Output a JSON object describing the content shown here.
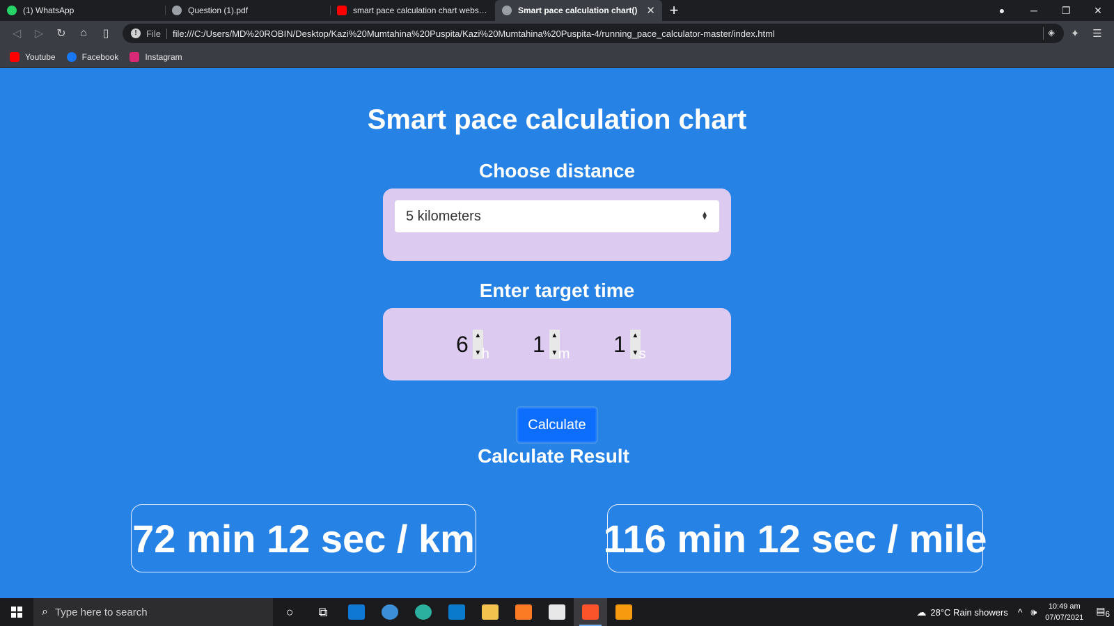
{
  "browser": {
    "tabs": [
      {
        "title": "(1) WhatsApp",
        "icon": "whatsapp-icon",
        "color": "#25d366"
      },
      {
        "title": "Question (1).pdf",
        "icon": "globe-icon",
        "color": "#9aa0a6"
      },
      {
        "title": "smart pace calculation chart website -",
        "icon": "youtube-icon",
        "color": "#ff0000"
      },
      {
        "title": "Smart pace calculation chart()",
        "icon": "globe-icon",
        "color": "#9aa0a6"
      }
    ],
    "address": {
      "scheme_label": "File",
      "url": "file:///C:/Users/MD%20ROBIN/Desktop/Kazi%20Mumtahina%20Puspita/Kazi%20Mumtahina%20Puspita-4/running_pace_calculator-master/index.html"
    },
    "bookmarks": [
      {
        "label": "Youtube",
        "icon": "youtube-icon"
      },
      {
        "label": "Facebook",
        "icon": "facebook-icon"
      },
      {
        "label": "Instagram",
        "icon": "instagram-icon"
      }
    ]
  },
  "page": {
    "title": "Smart pace calculation chart",
    "distance_heading": "Choose distance",
    "distance_selected": "5 kilometers",
    "time_heading": "Enter target time",
    "time": {
      "hours": "6",
      "hours_unit": "h",
      "minutes": "1",
      "minutes_unit": "m",
      "seconds": "1",
      "seconds_unit": "s"
    },
    "calculate_label": "Calculate",
    "result_heading": "Calculate Result",
    "result_km": "72 min 12 sec / km",
    "result_mile": "116 min 12 sec / mile"
  },
  "taskbar": {
    "search_placeholder": "Type here to search",
    "weather": "28°C  Rain showers",
    "time": "10:49 am",
    "date": "07/07/2021",
    "notifications": "6"
  },
  "colors": {
    "page_bg": "#2782e6",
    "panel_bg": "#dccaf0",
    "button": "#0d6efd"
  }
}
